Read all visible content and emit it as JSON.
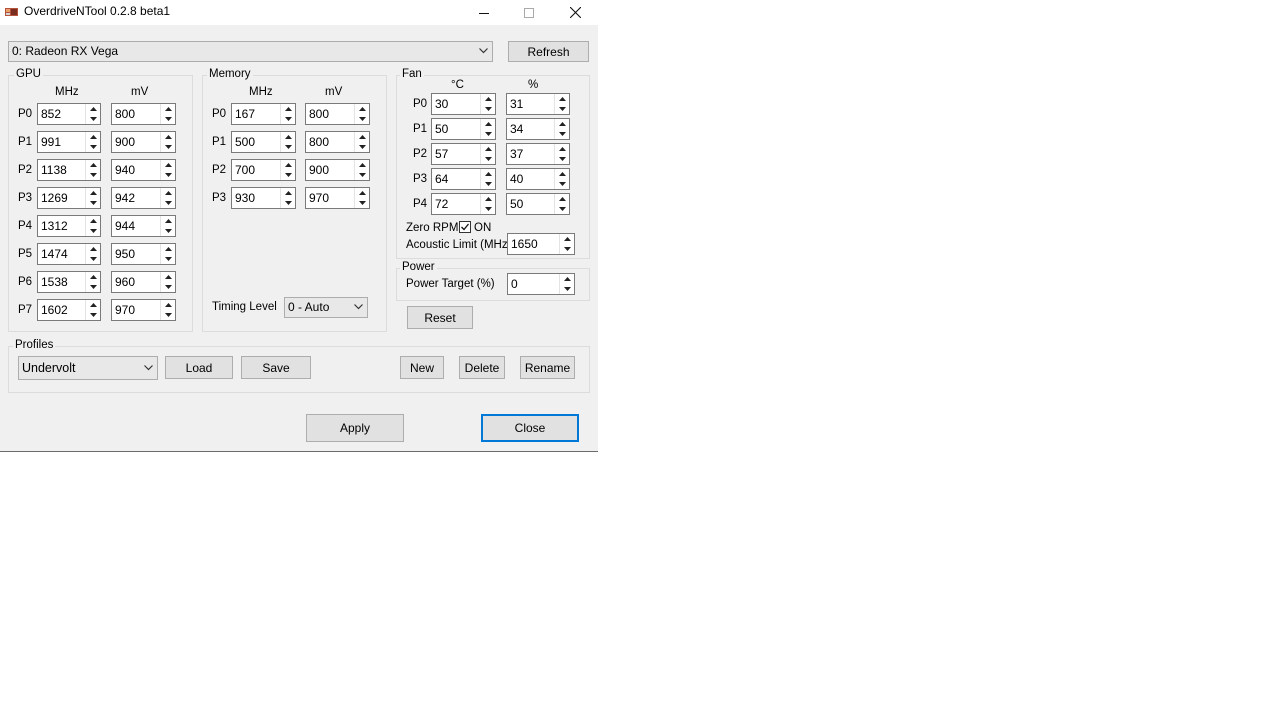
{
  "window": {
    "title": "OverdriveNTool 0.2.8 beta1"
  },
  "device": {
    "selected": "0: Radeon RX Vega",
    "refresh_label": "Refresh"
  },
  "gpu": {
    "title": "GPU",
    "col_mhz": "MHz",
    "col_mv": "mV",
    "rows": [
      {
        "label": "P0",
        "mhz": "852",
        "mv": "800"
      },
      {
        "label": "P1",
        "mhz": "991",
        "mv": "900"
      },
      {
        "label": "P2",
        "mhz": "1138",
        "mv": "940"
      },
      {
        "label": "P3",
        "mhz": "1269",
        "mv": "942"
      },
      {
        "label": "P4",
        "mhz": "1312",
        "mv": "944"
      },
      {
        "label": "P5",
        "mhz": "1474",
        "mv": "950"
      },
      {
        "label": "P6",
        "mhz": "1538",
        "mv": "960"
      },
      {
        "label": "P7",
        "mhz": "1602",
        "mv": "970"
      }
    ]
  },
  "memory": {
    "title": "Memory",
    "col_mhz": "MHz",
    "col_mv": "mV",
    "rows": [
      {
        "label": "P0",
        "mhz": "167",
        "mv": "800"
      },
      {
        "label": "P1",
        "mhz": "500",
        "mv": "800"
      },
      {
        "label": "P2",
        "mhz": "700",
        "mv": "900"
      },
      {
        "label": "P3",
        "mhz": "930",
        "mv": "970"
      }
    ],
    "timing_label": "Timing Level",
    "timing_value": "0 - Auto"
  },
  "fan": {
    "title": "Fan",
    "col_temp": "°C",
    "col_pct": "%",
    "rows": [
      {
        "label": "P0",
        "temp": "30",
        "pct": "31"
      },
      {
        "label": "P1",
        "temp": "50",
        "pct": "34"
      },
      {
        "label": "P2",
        "temp": "57",
        "pct": "37"
      },
      {
        "label": "P3",
        "temp": "64",
        "pct": "40"
      },
      {
        "label": "P4",
        "temp": "72",
        "pct": "50"
      }
    ],
    "zero_rpm_label": "Zero RPM",
    "zero_rpm_checked": true,
    "zero_rpm_state": "ON",
    "acoustic_label": "Acoustic Limit (MHz)",
    "acoustic_value": "1650"
  },
  "power": {
    "title": "Power",
    "target_label": "Power Target (%)",
    "target_value": "0",
    "reset_label": "Reset"
  },
  "profiles": {
    "title": "Profiles",
    "selected": "Undervolt",
    "load_label": "Load",
    "save_label": "Save",
    "new_label": "New",
    "delete_label": "Delete",
    "rename_label": "Rename"
  },
  "footer": {
    "apply_label": "Apply",
    "close_label": "Close"
  }
}
